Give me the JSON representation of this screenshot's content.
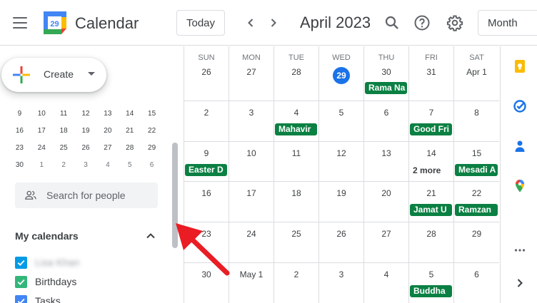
{
  "header": {
    "app_title": "Calendar",
    "logo_day": "29",
    "today_label": "Today",
    "month_title": "April 2023",
    "view_label": "Month"
  },
  "sidebar": {
    "create_label": "Create",
    "mini_calendar": [
      [
        "9",
        "10",
        "11",
        "12",
        "13",
        "14",
        "15"
      ],
      [
        "16",
        "17",
        "18",
        "19",
        "20",
        "21",
        "22"
      ],
      [
        "23",
        "24",
        "25",
        "26",
        "27",
        "28",
        "29"
      ],
      [
        "30",
        "1",
        "2",
        "3",
        "4",
        "5",
        "6"
      ]
    ],
    "search_people_placeholder": "Search for people",
    "my_calendars_label": "My calendars",
    "calendars": [
      {
        "label": "Lisa Khan",
        "color": "#039be5",
        "blurred": true
      },
      {
        "label": "Birthdays",
        "color": "#33b679",
        "blurred": false
      },
      {
        "label": "Tasks",
        "color": "#4285f4",
        "blurred": false
      }
    ]
  },
  "grid": {
    "weekdays": [
      "SUN",
      "MON",
      "TUE",
      "WED",
      "THU",
      "FRI",
      "SAT"
    ],
    "weeks": [
      [
        "26",
        "27",
        "28",
        "29",
        "30",
        "31",
        "Apr 1"
      ],
      [
        "2",
        "3",
        "4",
        "5",
        "6",
        "7",
        "8"
      ],
      [
        "9",
        "10",
        "11",
        "12",
        "13",
        "14",
        "15"
      ],
      [
        "16",
        "17",
        "18",
        "19",
        "20",
        "21",
        "22"
      ],
      [
        "23",
        "24",
        "25",
        "26",
        "27",
        "28",
        "29"
      ],
      [
        "30",
        "May 1",
        "2",
        "3",
        "4",
        "5",
        "6"
      ]
    ],
    "today_index": [
      0,
      3
    ],
    "events": [
      {
        "week": 0,
        "day": 4,
        "label": "Rama Na"
      },
      {
        "week": 1,
        "day": 2,
        "label": "Mahavir"
      },
      {
        "week": 1,
        "day": 5,
        "label": "Good Fri"
      },
      {
        "week": 2,
        "day": 0,
        "label": "Easter D"
      },
      {
        "week": 2,
        "day": 6,
        "label": "Mesadi A"
      },
      {
        "week": 3,
        "day": 5,
        "label": "Jamat U"
      },
      {
        "week": 3,
        "day": 6,
        "label": "Ramzan"
      },
      {
        "week": 5,
        "day": 5,
        "label": "Buddha"
      }
    ],
    "more": {
      "week": 2,
      "day": 5,
      "label": "2 more"
    },
    "event_color": "#0b8043",
    "today_color": "#1a73e8"
  },
  "rail": {
    "icons": [
      "keep-icon",
      "tasks-icon",
      "contacts-icon",
      "maps-icon",
      "more-icon",
      "expand-icon"
    ]
  }
}
